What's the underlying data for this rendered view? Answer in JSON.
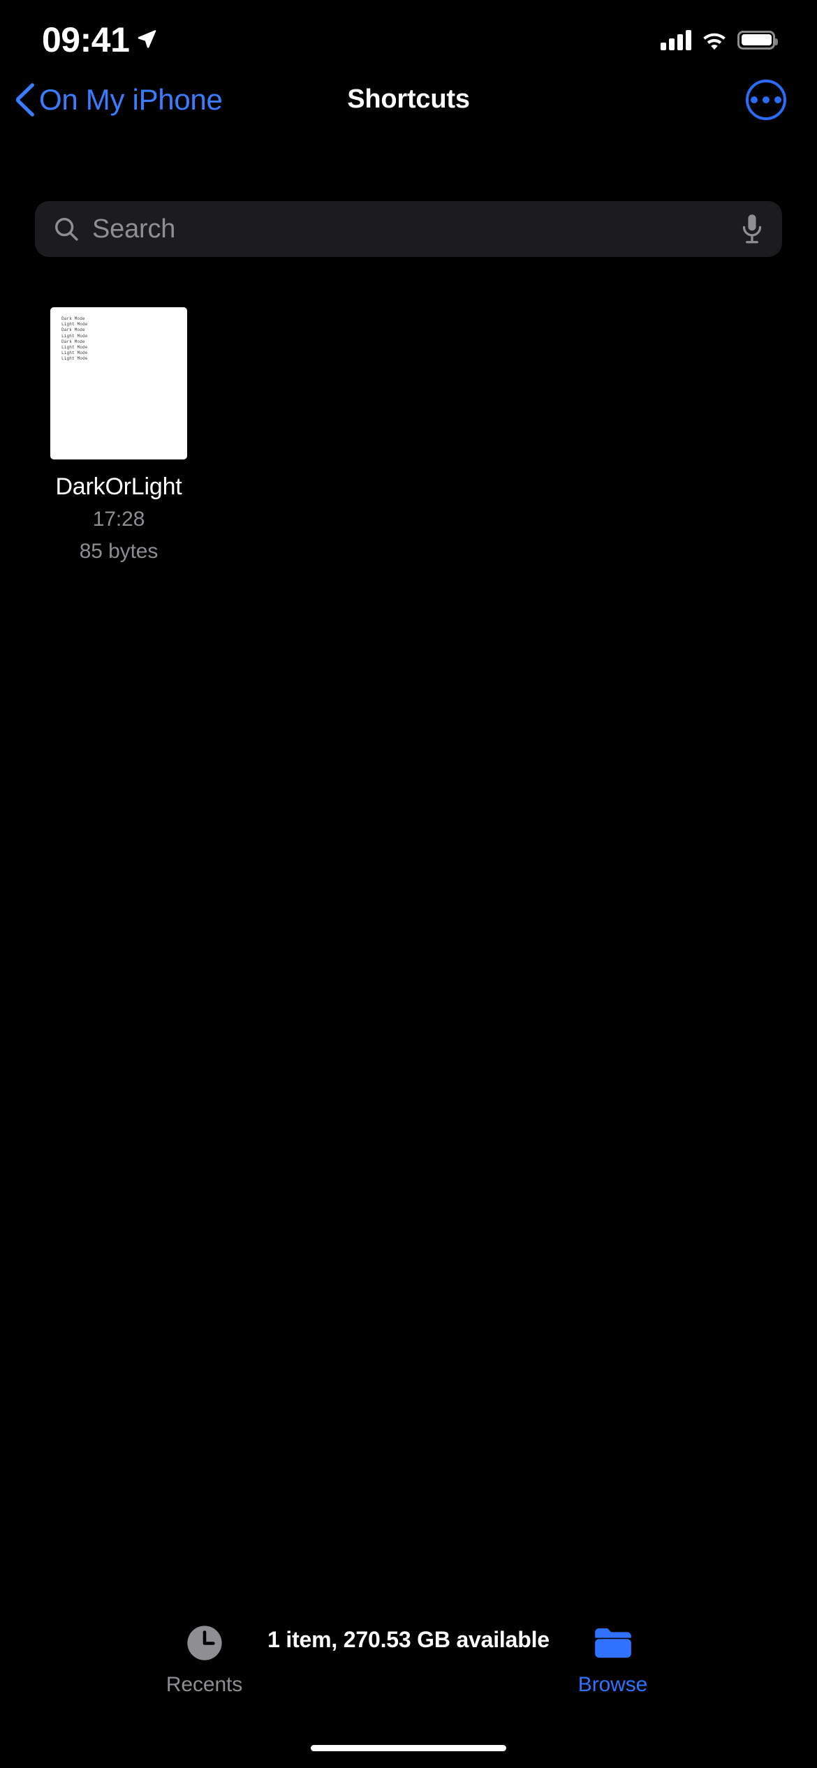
{
  "status_bar": {
    "time": "09:41",
    "location_icon": "location-arrow-icon",
    "cellular_icon": "cellular-signal-icon",
    "wifi_icon": "wifi-icon",
    "battery_icon": "battery-full-icon"
  },
  "nav_bar": {
    "back_label": "On My iPhone",
    "back_icon": "chevron-left-icon",
    "title": "Shortcuts",
    "more_icon": "ellipsis-circle-icon"
  },
  "search": {
    "placeholder": "Search",
    "search_icon": "magnifying-glass-icon",
    "dictate_icon": "microphone-icon"
  },
  "files": [
    {
      "name": "DarkOrLight",
      "time": "17:28",
      "size": "85 bytes",
      "preview_lines": [
        "Dark Mode",
        "Light Mode",
        "Dark Mode",
        "Light Mode",
        "Dark Mode",
        "Light Mode",
        "Light Mode",
        "Light Mode"
      ]
    }
  ],
  "footer": {
    "status": "1 item, 270.53 GB available"
  },
  "tab_bar": {
    "tabs": [
      {
        "label": "Recents",
        "icon": "clock-icon",
        "active": false
      },
      {
        "label": "Browse",
        "icon": "folder-icon",
        "active": true
      }
    ]
  },
  "colors": {
    "accent": "#2f72ff",
    "background": "#000000",
    "search_field": "#1c1c1e",
    "secondary_text": "#8e8e93"
  }
}
